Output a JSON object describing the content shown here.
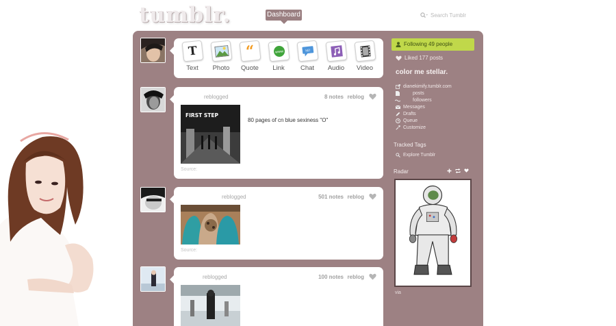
{
  "header": {
    "logo": "tumblr.",
    "dashboard_tab": "Dashboard",
    "search_placeholder": "Search Tumblr"
  },
  "post_types": [
    {
      "label": "Text",
      "icon": "text-icon"
    },
    {
      "label": "Photo",
      "icon": "photo-icon"
    },
    {
      "label": "Quote",
      "icon": "quote-icon"
    },
    {
      "label": "Link",
      "icon": "link-icon"
    },
    {
      "label": "Chat",
      "icon": "chat-icon"
    },
    {
      "label": "Audio",
      "icon": "audio-icon"
    },
    {
      "label": "Video",
      "icon": "video-icon"
    }
  ],
  "posts": [
    {
      "action": "reblogged",
      "notes": "8 notes",
      "reblog": "reblog",
      "photo_title": "FIRST STEP",
      "caption": "80 pages of cn blue sexiness \"O\"",
      "source": "Source:"
    },
    {
      "action": "reblogged",
      "notes": "501 notes",
      "reblog": "reblog",
      "source": "Source:"
    },
    {
      "action": "reblogged",
      "notes": "100 notes",
      "reblog": "reblog"
    }
  ],
  "sidebar": {
    "following": "Following 49 people",
    "liked": "Liked 177 posts",
    "blog_name": "color me stellar.",
    "menu": [
      {
        "label": "dianekimify.tumblr.com",
        "icon": "external-link-icon"
      },
      {
        "label": "posts",
        "icon": "document-icon"
      },
      {
        "label": "followers",
        "icon": "users-icon"
      },
      {
        "label": "Messages",
        "icon": "mail-icon"
      },
      {
        "label": "Drafts",
        "icon": "drafts-icon"
      },
      {
        "label": "Queue",
        "icon": "clock-icon"
      },
      {
        "label": "Customize",
        "icon": "wrench-icon"
      }
    ],
    "tracked_tags_title": "Tracked Tags",
    "explore": "Explore Tumblr",
    "radar_title": "Radar",
    "radar_caption": "via"
  },
  "colors": {
    "panel": "#9d8183",
    "follow_bg": "#c0d84a",
    "dashboard_tab": "#9a7f81"
  }
}
